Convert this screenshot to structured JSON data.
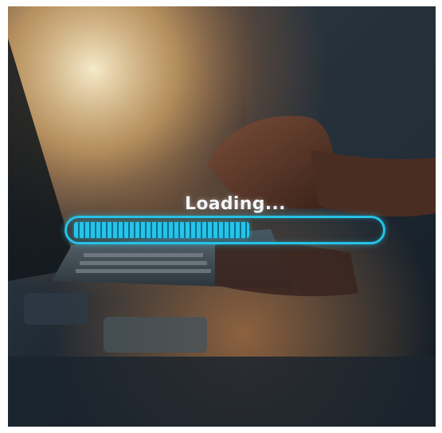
{
  "loading": {
    "label": "Loading...",
    "progress_fraction": 0.58,
    "accent_color": "#26c2e6"
  }
}
